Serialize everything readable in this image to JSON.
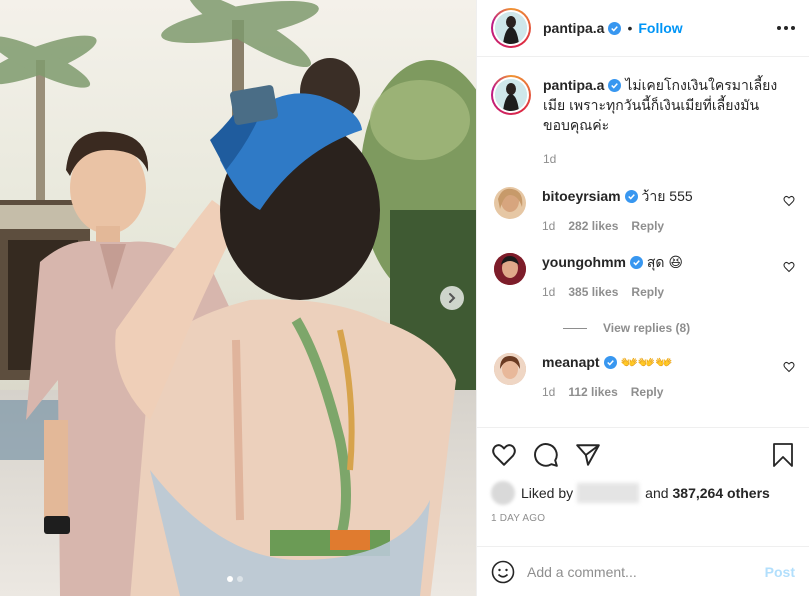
{
  "post": {
    "username": "pantipa.a",
    "follow_label": "Follow",
    "separator": "•",
    "caption": "ไม่เคยโกงเงินใครมาเลี้ยงเมีย เพราะทุกวันนี้ก็เงินเมียที่เลี้ยงมัน ขอบคุณค่ะ",
    "caption_age": "1d",
    "carousel": {
      "slide_count": 2,
      "active_index": 0
    }
  },
  "comments": [
    {
      "username": "bitoeyrsiam",
      "text": "ว้าย 555",
      "age": "1d",
      "likes": "282 likes",
      "reply_label": "Reply",
      "avatar_color": "#e6c7a4"
    },
    {
      "username": "youngohmm",
      "text": "สุด 😆",
      "age": "1d",
      "likes": "385 likes",
      "reply_label": "Reply",
      "avatar_color": "#b7333d"
    },
    {
      "username": "meanapt",
      "text": "👐👐👐",
      "age": "1d",
      "likes": "112 likes",
      "reply_label": "Reply",
      "avatar_color": "#d9a98a"
    }
  ],
  "view_replies": "View replies (8)",
  "liked_by": {
    "prefix": "Liked by",
    "suffix": "and",
    "others": "387,264 others"
  },
  "timestamp": "1 DAY AGO",
  "add_comment": {
    "placeholder": "Add a comment...",
    "post_label": "Post"
  },
  "icons": {
    "like": "heart-icon",
    "comment": "comment-bubble-icon",
    "share": "paper-plane-icon",
    "save": "bookmark-icon",
    "emoji": "smiley-icon",
    "more": "more-options-icon",
    "next": "chevron-right-icon",
    "verified": "verified-badge-icon"
  },
  "colors": {
    "accent": "#0095f6",
    "verified": "#3897f0",
    "muted": "#8e8e8e",
    "post_disabled": "#b2dffc"
  }
}
